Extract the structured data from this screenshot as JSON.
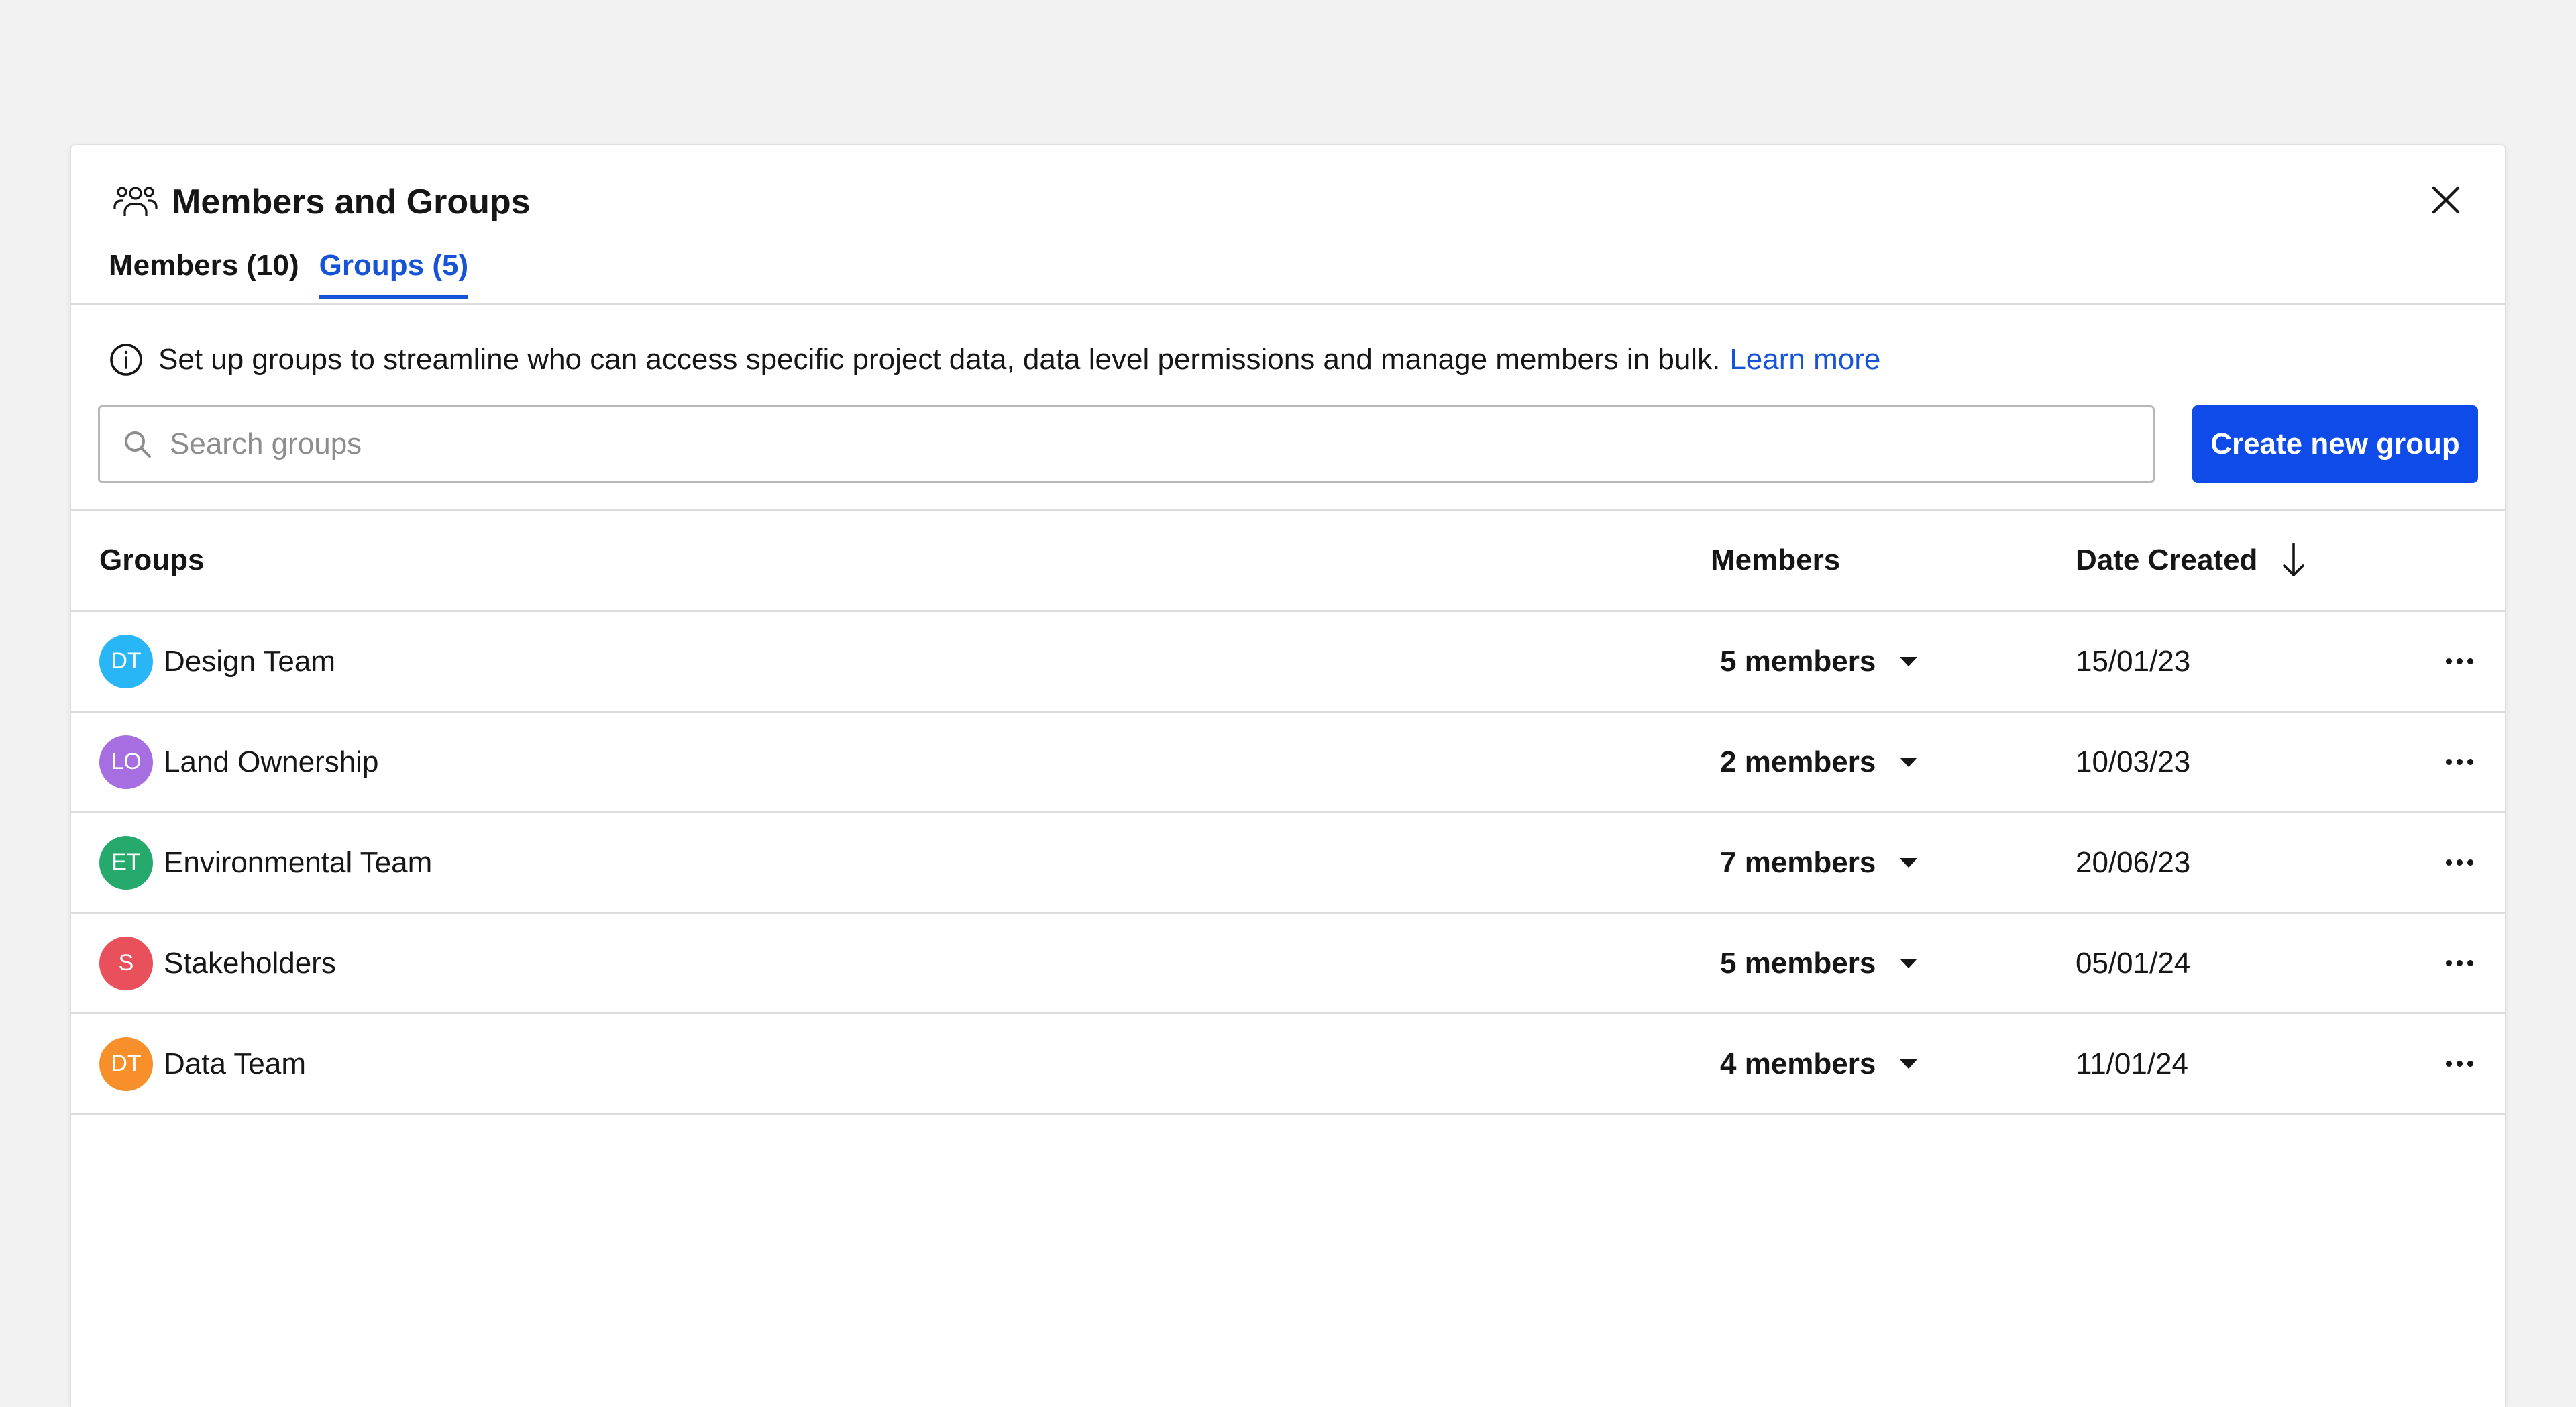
{
  "dialog": {
    "title": "Members and Groups",
    "tabs": [
      {
        "label": "Members (10)",
        "active": false
      },
      {
        "label": "Groups (5)",
        "active": true
      }
    ],
    "info_text": "Set up groups to streamline who can access specific project data, data level permissions and manage members in bulk.",
    "learn_more": "Learn more",
    "search": {
      "placeholder": "Search groups",
      "value": ""
    },
    "create_button": "Create new group",
    "table": {
      "headers": {
        "groups": "Groups",
        "members": "Members",
        "date": "Date Created"
      },
      "sort": "descending",
      "rows": [
        {
          "initials": "DT",
          "name": "Design Team",
          "members": "5 members",
          "date": "15/01/23",
          "color": "#29b6f6"
        },
        {
          "initials": "LO",
          "name": "Land Ownership",
          "members": "2 members",
          "date": "10/03/23",
          "color": "#a66ee0"
        },
        {
          "initials": "ET",
          "name": "Environmental Team",
          "members": "7 members",
          "date": "20/06/23",
          "color": "#26a96c"
        },
        {
          "initials": "S",
          "name": "Stakeholders",
          "members": "5 members",
          "date": "05/01/24",
          "color": "#e8505b"
        },
        {
          "initials": "DT",
          "name": "Data Team",
          "members": "4 members",
          "date": "11/01/24",
          "color": "#f7902b"
        }
      ]
    }
  },
  "colors": {
    "accent": "#1753d6",
    "primary_button": "#0f4be8",
    "background": "#f2f2f2",
    "divider": "#dcdcdc"
  },
  "icons": {
    "header": "people-group-icon",
    "close": "close-icon",
    "info": "info-icon",
    "search": "search-icon",
    "sort": "arrow-down-icon",
    "row_menu": "more-horizontal-icon",
    "members_dropdown": "caret-down-icon"
  }
}
